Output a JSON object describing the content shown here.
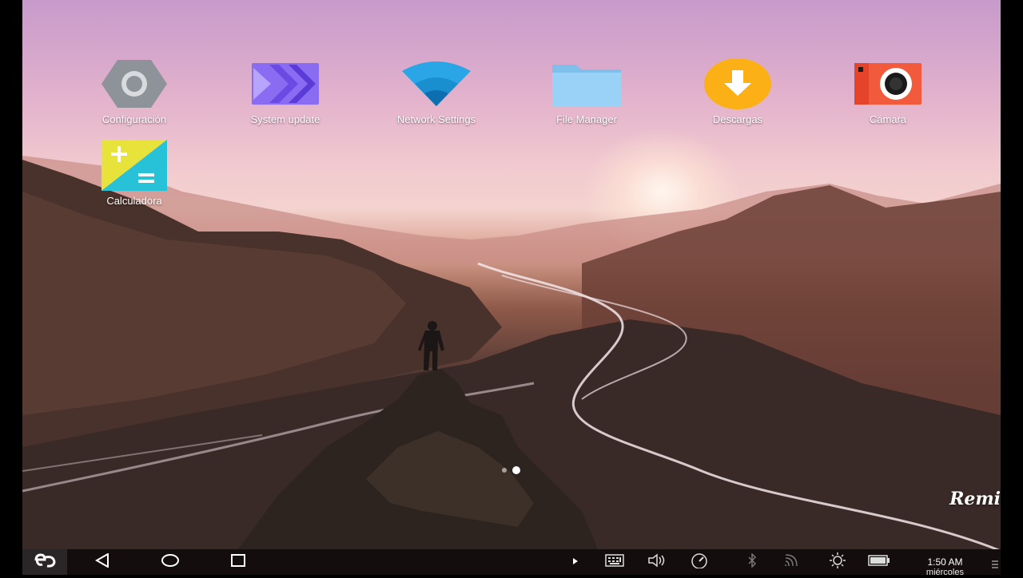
{
  "desktop": {
    "apps": [
      {
        "id": "settings",
        "label": "Configuración",
        "icon": "gear-icon"
      },
      {
        "id": "system-update",
        "label": "System update",
        "icon": "forward-arrows-icon"
      },
      {
        "id": "network-settings",
        "label": "Network Settings",
        "icon": "wifi-icon"
      },
      {
        "id": "file-manager",
        "label": "File Manager",
        "icon": "folder-icon"
      },
      {
        "id": "downloads",
        "label": "Descargas",
        "icon": "download-icon"
      },
      {
        "id": "camera",
        "label": "Cámara",
        "icon": "camera-icon"
      },
      {
        "id": "calculator",
        "label": "Calculadora",
        "icon": "calculator-icon"
      }
    ],
    "page_indicator": {
      "pages": 2,
      "current": 2
    },
    "watermark": "Remi"
  },
  "taskbar": {
    "start_icon": "remix-logo-icon",
    "nav": [
      "back-icon",
      "home-icon",
      "recents-icon"
    ],
    "tray": [
      "expand-tray-icon",
      "keyboard-icon",
      "volume-icon",
      "performance-icon",
      "bluetooth-icon",
      "wifi-signal-icon",
      "brightness-icon",
      "battery-icon"
    ],
    "clock": {
      "time": "1:50 AM",
      "day": "miércoles"
    }
  },
  "colors": {
    "taskbar_bg": "#140d0e",
    "settings_icon": "#8e9299",
    "update_icon": "#7b5cf0",
    "wifi_icon": "#2aa6e6",
    "folder_icon": "#8fcaf2",
    "download_icon": "#fbb116",
    "camera_icon": "#f25a3c",
    "calculator_yellow": "#e8e33a",
    "calculator_cyan": "#27c2d8"
  }
}
